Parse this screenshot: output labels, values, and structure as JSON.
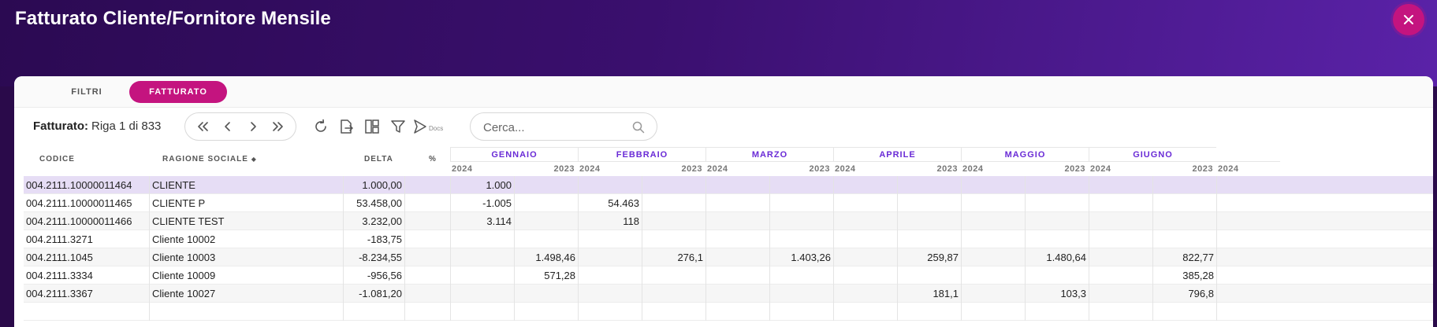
{
  "window": {
    "title": "Fatturato Cliente/Fornitore Mensile"
  },
  "tabs": [
    {
      "label": "FILTRI",
      "active": false
    },
    {
      "label": "FATTURATO",
      "active": true
    }
  ],
  "toolbar": {
    "label": "Fatturato:",
    "row_info": "Riga 1 di 833",
    "icons": [
      "first-page-icon",
      "prev-page-icon",
      "next-page-icon",
      "last-page-icon",
      "refresh-icon",
      "export-icon",
      "columns-layout-icon",
      "filter-icon",
      "docs-icon"
    ],
    "docs_label": "Docs",
    "search": {
      "placeholder": "Cerca...",
      "value": ""
    }
  },
  "columns": {
    "codice": "CODICE",
    "ragione_sociale": "RAGIONE SOCIALE",
    "delta": "DELTA",
    "percent": "%"
  },
  "months": [
    "GENNAIO",
    "FEBBRAIO",
    "MARZO",
    "APRILE",
    "MAGGIO",
    "GIUGNO"
  ],
  "years": [
    "2024",
    "2023",
    "2024",
    "2023",
    "2024",
    "2023",
    "2024",
    "2023",
    "2024",
    "2023",
    "2024",
    "2023",
    "2024"
  ],
  "rows": [
    {
      "codice": "004.2111.10000011464",
      "ragione": "CLIENTE",
      "delta": "1.000,00",
      "percent": "",
      "vals": [
        "1.000",
        "",
        "",
        "",
        "",
        "",
        "",
        "",
        "",
        "",
        "",
        "",
        ""
      ]
    },
    {
      "codice": "004.2111.10000011465",
      "ragione": "CLIENTE P",
      "delta": "53.458,00",
      "percent": "",
      "vals": [
        "-1.005",
        "",
        "54.463",
        "",
        "",
        "",
        "",
        "",
        "",
        "",
        "",
        "",
        ""
      ]
    },
    {
      "codice": "004.2111.10000011466",
      "ragione": "CLIENTE TEST",
      "delta": "3.232,00",
      "percent": "",
      "vals": [
        "3.114",
        "",
        "118",
        "",
        "",
        "",
        "",
        "",
        "",
        "",
        "",
        "",
        ""
      ]
    },
    {
      "codice": "004.2111.3271",
      "ragione": "Cliente 10002",
      "delta": "-183,75",
      "percent": "",
      "vals": [
        "",
        "",
        "",
        "",
        "",
        "",
        "",
        "",
        "",
        "",
        "",
        "",
        ""
      ]
    },
    {
      "codice": "004.2111.1045",
      "ragione": "Cliente 10003",
      "delta": "-8.234,55",
      "percent": "",
      "vals": [
        "",
        "1.498,46",
        "",
        "276,1",
        "",
        "1.403,26",
        "",
        "259,87",
        "",
        "1.480,64",
        "",
        "822,77",
        ""
      ]
    },
    {
      "codice": "004.2111.3334",
      "ragione": "Cliente 10009",
      "delta": "-956,56",
      "percent": "",
      "vals": [
        "",
        "571,28",
        "",
        "",
        "",
        "",
        "",
        "",
        "",
        "",
        "",
        "385,28",
        ""
      ]
    },
    {
      "codice": "004.2111.3367",
      "ragione": "Cliente 10027",
      "delta": "-1.081,20",
      "percent": "",
      "vals": [
        "",
        "",
        "",
        "",
        "",
        "",
        "",
        "181,1",
        "",
        "103,3",
        "",
        "796,8",
        ""
      ]
    },
    {
      "codice": "",
      "ragione": "",
      "delta": "",
      "percent": "",
      "vals": [
        "",
        "",
        "",
        "",
        "",
        "",
        "",
        "",
        "",
        "",
        "",
        "",
        ""
      ]
    }
  ],
  "colors": {
    "accent": "#c4147f",
    "month_header": "#6a2bd6",
    "selected_row": "#e6ddf5",
    "header_bg_start": "#2b0a52",
    "header_bg_end": "#5a22a8"
  }
}
